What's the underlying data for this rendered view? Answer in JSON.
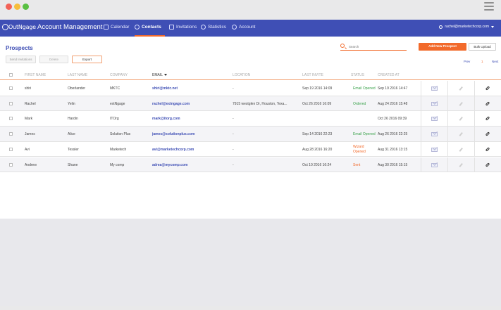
{
  "window": {
    "dots": [
      "#f26257",
      "#f6be3b",
      "#59c043"
    ]
  },
  "nav": {
    "logo": "OutNgage",
    "app_title": "Account Management",
    "items": [
      {
        "label": "Calendar",
        "icon": "calendar-icon"
      },
      {
        "label": "Contacts",
        "icon": "contacts-icon"
      },
      {
        "label": "Invitations",
        "icon": "invitations-icon"
      },
      {
        "label": "Statistics",
        "icon": "statistics-icon"
      },
      {
        "label": "Account",
        "icon": "account-icon"
      }
    ],
    "active": "Contacts",
    "user_email": "rachel@marketechcorp.com",
    "accent": "#f26a2b",
    "bar_color": "#3f4fb5"
  },
  "page": {
    "title": "Prospects",
    "search_placeholder": "Search",
    "buttons": {
      "add": "Add New Prospect",
      "bulk": "Bulk Upload",
      "send": "Send Invitations",
      "delete": "Delete",
      "export": "Export"
    },
    "pager": {
      "prev": "Prev",
      "current": "1",
      "next": "Next"
    }
  },
  "table": {
    "headers": {
      "first": "FIRST NAME",
      "last": "LAST NAME",
      "company": "COMPANY",
      "email": "EMAIL",
      "location": "LOCATION",
      "last_invite": "LAST INVITE",
      "status": "STATUS",
      "created": "CREATED AT"
    },
    "rows": [
      {
        "first": "shiri",
        "last": "Oberlander",
        "company": "MKTC",
        "email": "shiri@mktc.net",
        "location": "-",
        "last_invite": "Sep 19 2016 14:09",
        "status": "Email Opened",
        "status_line2": "",
        "status_kind": "opened",
        "created": "Sep 19 2016 14:47"
      },
      {
        "first": "Rachel",
        "last": "Yelin",
        "company": "extNgage",
        "email": "rachel@extngage.com",
        "location": "7915 westglen Dr, Houston, Texa...",
        "last_invite": "Oct 26 2016 16:09",
        "status": "Ordered",
        "status_line2": "",
        "status_kind": "ordered",
        "created": "Aug 24 2016 15:48"
      },
      {
        "first": "Mark",
        "last": "Hardin",
        "company": "ITOrg",
        "email": "mark@itorg.com",
        "location": "-",
        "last_invite": "",
        "status": "",
        "status_line2": "",
        "status_kind": "none",
        "created": "Oct 26 2016 09:39"
      },
      {
        "first": "James",
        "last": "Alice",
        "company": "Solution Plus",
        "email": "james@solutionplus.com",
        "location": "-",
        "last_invite": "Sep 14 2016 22:23",
        "status": "Email Opened",
        "status_line2": "",
        "status_kind": "opened",
        "created": "Aug 26 2016 22:25"
      },
      {
        "first": "Avi",
        "last": "Tessler",
        "company": "Marketech",
        "email": "avi@marketechcorp.com",
        "location": "-",
        "last_invite": "Aug 28 2016 16:20",
        "status": "Wizard",
        "status_line2": "Opened",
        "status_kind": "wizard",
        "created": "Aug 31 2016 13:15"
      },
      {
        "first": "Andrew",
        "last": "Shane",
        "company": "My comp",
        "email": "adrea@mycomp.com",
        "location": "-",
        "last_invite": "Oct 10 2016 16:24",
        "status": "Sent",
        "status_line2": "",
        "status_kind": "sent",
        "created": "Aug 30 2016 15:15"
      }
    ]
  }
}
